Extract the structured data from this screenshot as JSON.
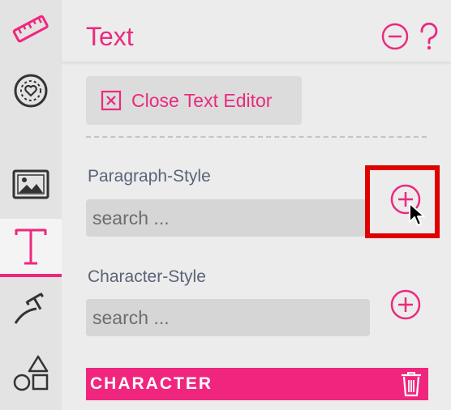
{
  "colors": {
    "accent": "#f0267e",
    "text_accent": "#ea2a7f",
    "label": "#5a6378",
    "highlight": "#e10000"
  },
  "rail": {
    "items": [
      {
        "name": "ruler-icon"
      },
      {
        "name": "heart-badge-icon"
      },
      {
        "name": "image-icon"
      },
      {
        "name": "text-tool-icon",
        "active": true
      },
      {
        "name": "path-tool-icon"
      },
      {
        "name": "shapes-icon"
      }
    ]
  },
  "header": {
    "title": "Text"
  },
  "close_editor": {
    "label": "Close Text Editor"
  },
  "paragraph_style": {
    "label": "Paragraph-Style",
    "placeholder": "search ..."
  },
  "character_style": {
    "label": "Character-Style",
    "placeholder": "search ..."
  },
  "character_bar": {
    "label": "CHARACTER"
  }
}
